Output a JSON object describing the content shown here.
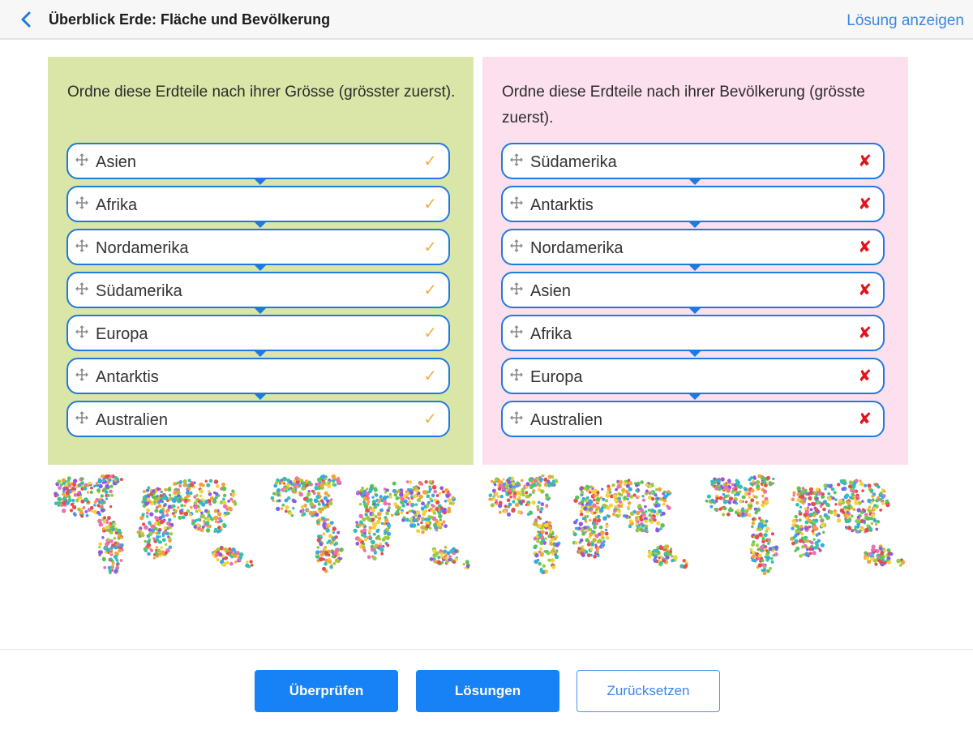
{
  "header": {
    "title": "Überblick Erde: Fläche und Bevölkerung",
    "solution_link": "Lösung anzeigen"
  },
  "panels": {
    "size": {
      "prompt": "Ordne diese Erdteile nach ihrer Grösse (grösster zuerst).",
      "background": "#d9e6a7",
      "items": [
        {
          "label": "Asien",
          "status": "correct"
        },
        {
          "label": "Afrika",
          "status": "correct"
        },
        {
          "label": "Nordamerika",
          "status": "correct"
        },
        {
          "label": "Südamerika",
          "status": "correct"
        },
        {
          "label": "Europa",
          "status": "correct"
        },
        {
          "label": "Antarktis",
          "status": "correct"
        },
        {
          "label": "Australien",
          "status": "correct"
        }
      ]
    },
    "population": {
      "prompt": "Ordne diese Erdteile nach ihrer Bevölkerung (grösste zuerst).",
      "background": "#fce0ee",
      "items": [
        {
          "label": "Südamerika",
          "status": "wrong"
        },
        {
          "label": "Antarktis",
          "status": "wrong"
        },
        {
          "label": "Nordamerika",
          "status": "wrong"
        },
        {
          "label": "Asien",
          "status": "wrong"
        },
        {
          "label": "Afrika",
          "status": "wrong"
        },
        {
          "label": "Europa",
          "status": "wrong"
        },
        {
          "label": "Australien",
          "status": "wrong"
        }
      ]
    }
  },
  "icons": {
    "correct": "check-icon",
    "wrong": "cross-icon",
    "grip": "move-handle-icon",
    "back": "chevron-left-icon"
  },
  "footer": {
    "check": "Überprüfen",
    "solutions": "Lösungen",
    "reset": "Zurücksetzen"
  },
  "colors": {
    "accent": "#1782f5",
    "link": "#3a86e6",
    "item_border": "#1f7ae0",
    "check": "#f0b04c",
    "cross": "#e0141c"
  }
}
